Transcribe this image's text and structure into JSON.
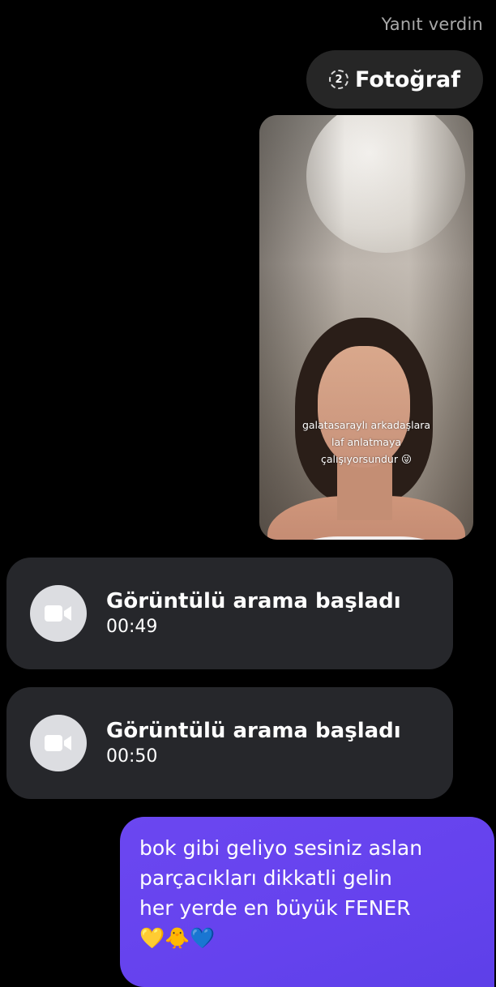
{
  "reply_label": "Yanıt verdin",
  "photo_pill": {
    "count": "2",
    "label": "Fotoğraf"
  },
  "photo": {
    "caption": [
      "galatasaraylı arkadaşlara",
      "laf anlatmaya",
      "çalışıyorsundur 😜"
    ]
  },
  "calls": [
    {
      "title": "Görüntülü arama başladı",
      "duration": "00:49"
    },
    {
      "title": "Görüntülü arama başladı",
      "duration": "00:50"
    }
  ],
  "outgoing_message": {
    "lines": [
      "bok gibi geliyo sesiniz aslan",
      "parçacıkları dikkatli gelin",
      "her yerde en büyük FENER",
      "💛🐥💙"
    ]
  },
  "colors": {
    "background": "#000000",
    "bubble_dark": "#26272b",
    "outgoing_bubble": "#6542ee",
    "muted_text": "#a8a8a8"
  }
}
